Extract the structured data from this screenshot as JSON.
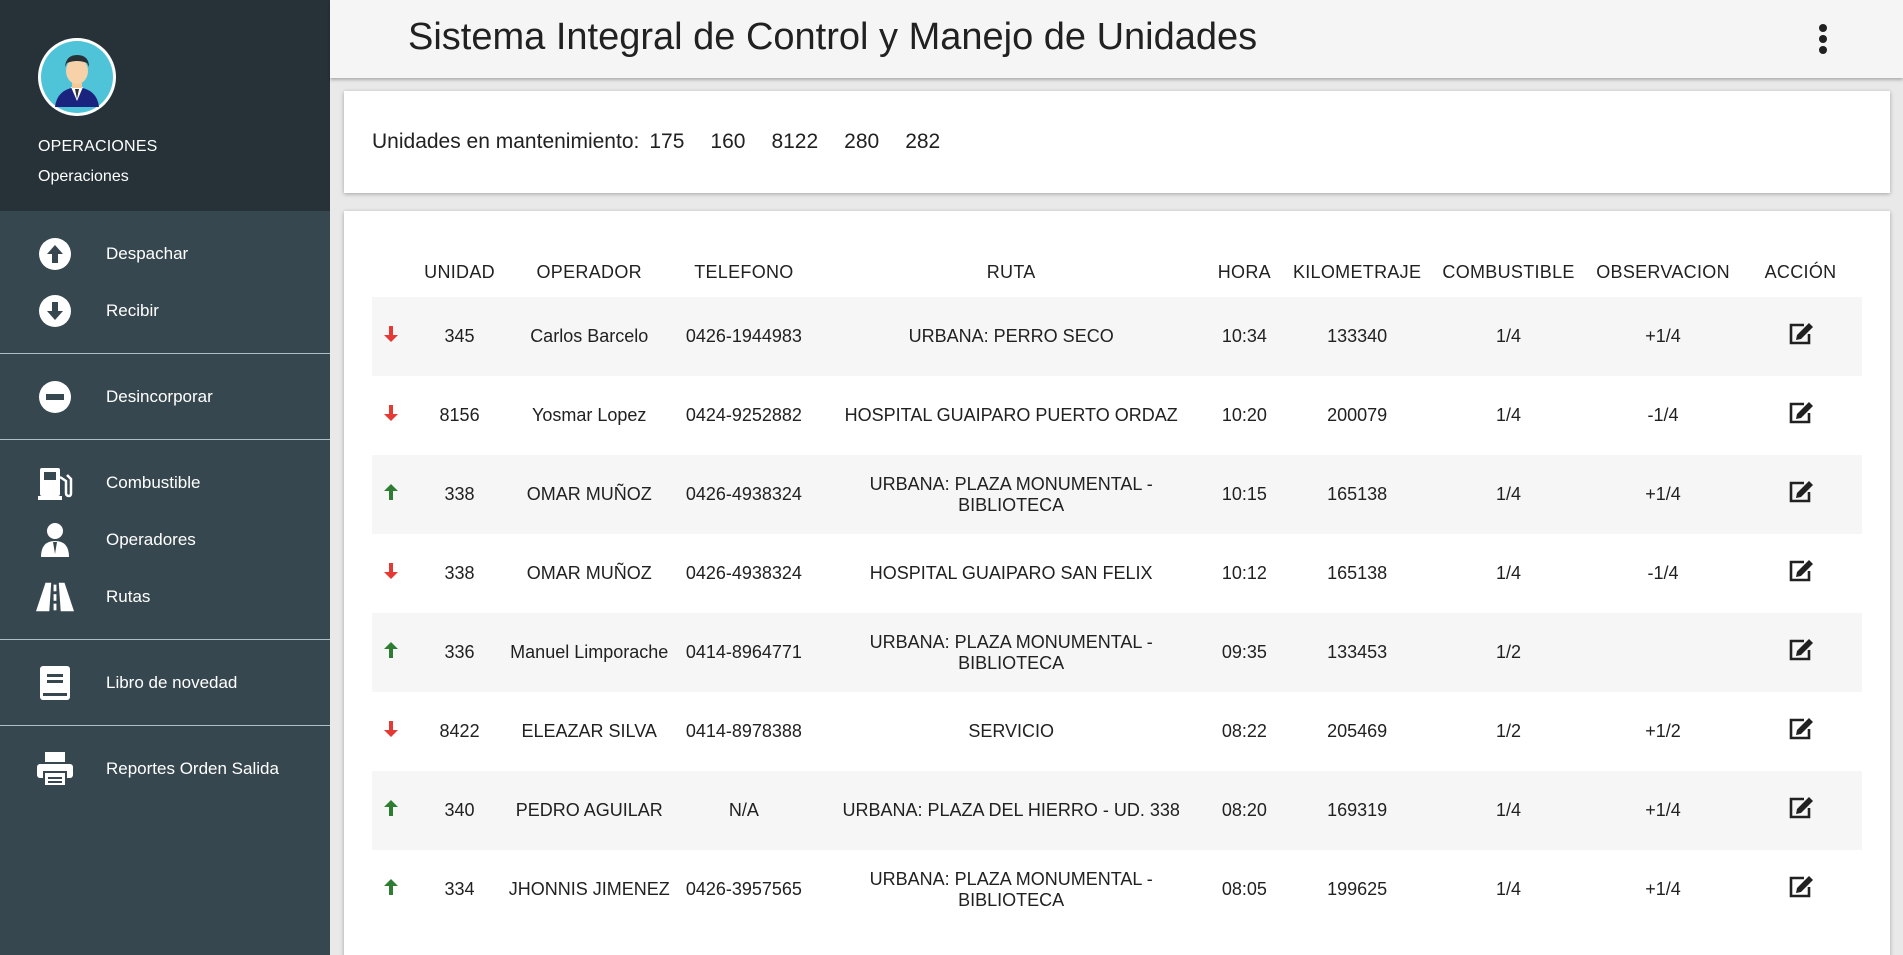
{
  "app": {
    "title": "Sistema Integral de Control y Manejo de Unidades"
  },
  "profile": {
    "role": "OPERACIONES",
    "subtitle": "Operaciones"
  },
  "sidebar": {
    "items": [
      {
        "label": "Despachar",
        "icon": "arrow-up-circle-icon"
      },
      {
        "label": "Recibir",
        "icon": "arrow-down-circle-icon"
      },
      {
        "label": "Desincorporar",
        "icon": "minus-circle-icon"
      },
      {
        "label": "Combustible",
        "icon": "gas-station-icon"
      },
      {
        "label": "Operadores",
        "icon": "user-tie-icon"
      },
      {
        "label": "Rutas",
        "icon": "road-icon"
      },
      {
        "label": "Libro de novedad",
        "icon": "book-icon"
      },
      {
        "label": "Reportes Orden Salida",
        "icon": "print-icon"
      }
    ]
  },
  "maintenance": {
    "label": "Unidades en mantenimiento:",
    "units": [
      "175",
      "160",
      "8122",
      "280",
      "282"
    ]
  },
  "table": {
    "columns": [
      "",
      "UNIDAD",
      "OPERADOR",
      "TELEFONO",
      "RUTA",
      "HORA",
      "KILOMETRAJE",
      "COMBUSTIBLE",
      "OBSERVACION",
      "ACCIÓN"
    ],
    "rows": [
      {
        "direction": "down",
        "unidad": "345",
        "operador": "Carlos Barcelo",
        "telefono": "0426-1944983",
        "ruta": "URBANA: PERRO SECO",
        "hora": "10:34",
        "km": "133340",
        "combustible": "1/4",
        "observacion": "+1/4"
      },
      {
        "direction": "down",
        "unidad": "8156",
        "operador": "Yosmar Lopez",
        "telefono": "0424-9252882",
        "ruta": "HOSPITAL GUAIPARO PUERTO ORDAZ",
        "hora": "10:20",
        "km": "200079",
        "combustible": "1/4",
        "observacion": "-1/4"
      },
      {
        "direction": "up",
        "unidad": "338",
        "operador": "OMAR MUÑOZ",
        "telefono": "0426-4938324",
        "ruta": "URBANA: PLAZA MONUMENTAL - BIBLIOTECA",
        "hora": "10:15",
        "km": "165138",
        "combustible": "1/4",
        "observacion": "+1/4"
      },
      {
        "direction": "down",
        "unidad": "338",
        "operador": "OMAR MUÑOZ",
        "telefono": "0426-4938324",
        "ruta": "HOSPITAL GUAIPARO SAN FELIX",
        "hora": "10:12",
        "km": "165138",
        "combustible": "1/4",
        "observacion": "-1/4"
      },
      {
        "direction": "up",
        "unidad": "336",
        "operador": "Manuel Limporache",
        "telefono": "0414-8964771",
        "ruta": "URBANA: PLAZA MONUMENTAL - BIBLIOTECA",
        "hora": "09:35",
        "km": "133453",
        "combustible": "1/2",
        "observacion": ""
      },
      {
        "direction": "down",
        "unidad": "8422",
        "operador": "ELEAZAR SILVA",
        "telefono": "0414-8978388",
        "ruta": "SERVICIO",
        "hora": "08:22",
        "km": "205469",
        "combustible": "1/2",
        "observacion": "+1/2"
      },
      {
        "direction": "up",
        "unidad": "340",
        "operador": "PEDRO AGUILAR",
        "telefono": "N/A",
        "ruta": "URBANA: PLAZA DEL HIERRO - UD. 338",
        "hora": "08:20",
        "km": "169319",
        "combustible": "1/4",
        "observacion": "+1/4"
      },
      {
        "direction": "up",
        "unidad": "334",
        "operador": "JHONNIS JIMENEZ",
        "telefono": "0426-3957565",
        "ruta": "URBANA: PLAZA MONUMENTAL - BIBLIOTECA",
        "hora": "08:05",
        "km": "199625",
        "combustible": "1/4",
        "observacion": "+1/4"
      }
    ]
  },
  "colors": {
    "sidebar": "#37474f",
    "profile_bg": "#263238",
    "arrow_down": "#e53935",
    "arrow_up": "#2e7d32"
  }
}
